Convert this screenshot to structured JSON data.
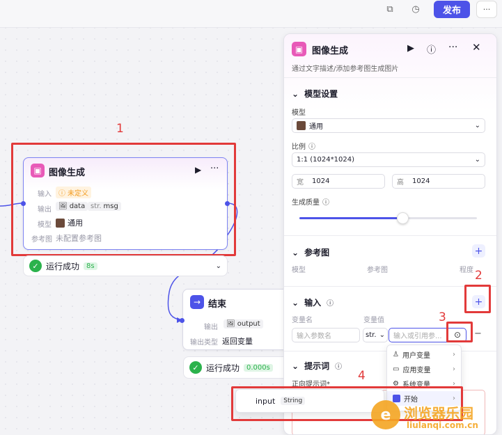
{
  "topbar": {
    "publish_label": "发布",
    "more_label": "···"
  },
  "annotations": {
    "n1": "1",
    "n2": "2",
    "n3": "3",
    "n4": "4"
  },
  "image_node": {
    "title": "图像生成",
    "rows": [
      {
        "label": "输入",
        "value": "未定义"
      },
      {
        "label": "输出",
        "tag1": "data",
        "tag2_prefix": "str.",
        "tag2": "msg"
      },
      {
        "label": "模型",
        "value": "通用"
      },
      {
        "label": "参考图",
        "value": "未配置参考图"
      }
    ],
    "status": "运行成功",
    "time": "8s"
  },
  "end_node": {
    "title": "结束",
    "out_label": "输出",
    "out_value": "output",
    "type_label": "输出类型",
    "type_value": "返回变量",
    "status": "运行成功",
    "time": "0.000s"
  },
  "panel": {
    "title": "图像生成",
    "desc": "通过文字描述/添加参考图生成图片",
    "model_section": "模型设置",
    "model_label": "模型",
    "model_value": "通用",
    "ratio_label": "比例",
    "ratio_value": "1:1 (1024*1024)",
    "width_label": "宽",
    "width_value": "1024",
    "height_label": "高",
    "height_value": "1024",
    "quality_label": "生成质量",
    "quality_level": 0.58,
    "ref_section": "参考图",
    "ref_cols": [
      "模型",
      "参考图",
      "程度"
    ],
    "input_section": "输入",
    "var_name_col": "变量名",
    "var_value_col": "变量值",
    "var_name_placeholder": "输入参数名",
    "var_type": "str.",
    "var_value_placeholder": "输入或引用参...",
    "prompt_section": "提示词",
    "pos_prompt_label": "正向提示词*"
  },
  "dropdown": {
    "items": [
      {
        "icon": "user-icon",
        "label": "用户变量"
      },
      {
        "icon": "folder-icon",
        "label": "应用变量"
      },
      {
        "icon": "gear-icon",
        "label": "系统变量"
      },
      {
        "icon": "start-icon",
        "label": "开始"
      }
    ]
  },
  "submenu": {
    "var": "input",
    "type": "String"
  },
  "watermark": {
    "line1": "浏览器乐园",
    "line2": "liulanqi.com.cn"
  }
}
